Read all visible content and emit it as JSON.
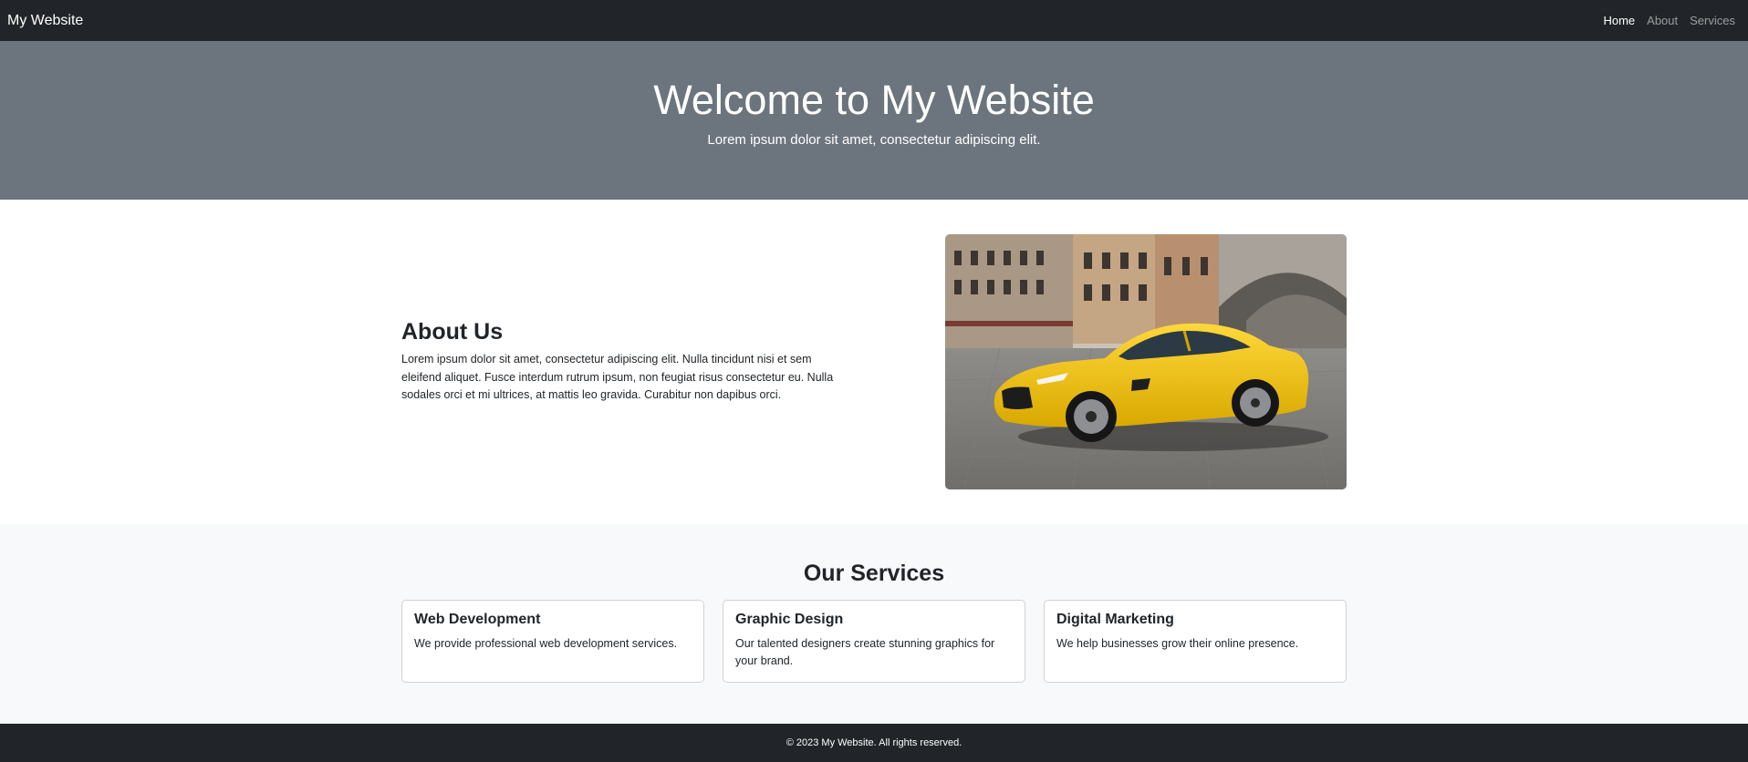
{
  "navbar": {
    "brand": "My Website",
    "links": [
      {
        "label": "Home",
        "active": true
      },
      {
        "label": "About",
        "active": false
      },
      {
        "label": "Services",
        "active": false
      }
    ]
  },
  "hero": {
    "title": "Welcome to My Website",
    "subtitle": "Lorem ipsum dolor sit amet, consectetur adipiscing elit."
  },
  "about": {
    "heading": "About Us",
    "body": "Lorem ipsum dolor sit amet, consectetur adipiscing elit. Nulla tincidunt nisi et sem eleifend aliquet. Fusce interdum rutrum ipsum, non feugiat risus consectetur eu. Nulla sodales orci et mi ultrices, at mattis leo gravida. Curabitur non dapibus orci.",
    "image_subject": "yellow sports car on cobblestone plaza"
  },
  "services": {
    "heading": "Our Services",
    "cards": [
      {
        "title": "Web Development",
        "text": "We provide professional web development services."
      },
      {
        "title": "Graphic Design",
        "text": "Our talented designers create stunning graphics for your brand."
      },
      {
        "title": "Digital Marketing",
        "text": "We help businesses grow their online presence."
      }
    ]
  },
  "footer": {
    "text": "© 2023 My Website. All rights reserved."
  },
  "colors": {
    "navbar_bg": "#212529",
    "hero_bg": "#6c757d",
    "services_bg": "#f8f9fa",
    "car": "#f2c318"
  }
}
